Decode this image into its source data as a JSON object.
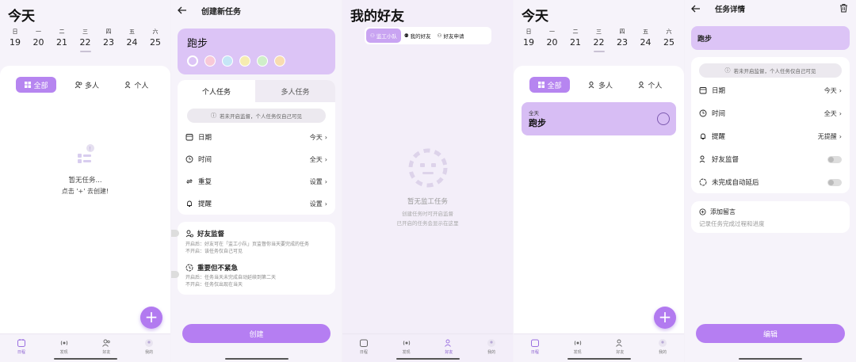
{
  "colors": {
    "accent": "#b57ef2",
    "accent_light": "#dcc4f6",
    "bg": "#f6f3fa"
  },
  "week": {
    "days": [
      "日",
      "一",
      "二",
      "三",
      "四",
      "五",
      "六"
    ],
    "dates": [
      "19",
      "20",
      "21",
      "22",
      "23",
      "24",
      "25"
    ],
    "selected_index": 3
  },
  "filter_tabs": [
    "全部",
    "多人",
    "个人"
  ],
  "bottom_nav": [
    "日程",
    "发现",
    "好友",
    "我的"
  ],
  "today_screen": {
    "title": "今天",
    "empty_line1": "暂无任务...",
    "empty_line2": "点击 '+' 去创建!",
    "fab": "+"
  },
  "create_screen": {
    "title": "创建新任务",
    "task_name": "跑步",
    "color_dots": [
      "#f8c9d8",
      "#c5e6f6",
      "#f6ecb1",
      "#cfeec9",
      "#f8dcb0"
    ],
    "tabs": [
      "个人任务",
      "多人任务"
    ],
    "notice": "若未开启监督，个人任务仅自己可见",
    "rows": [
      {
        "label": "日期",
        "value": "今天"
      },
      {
        "label": "时间",
        "value": "全天"
      },
      {
        "label": "重复",
        "value": "设置"
      },
      {
        "label": "提醒",
        "value": "设置"
      }
    ],
    "supervise_title": "好友监督",
    "supervise_desc1": "开启后：好友可在「监工小队」页监督你当天要完成的任务",
    "supervise_desc2": "不开启：该任务仅自己可见",
    "important_title": "重要但不紧急",
    "important_desc1": "开启后：任务当天未完成自动延续到第二天",
    "important_desc2": "不开启：任务仅出现在当天",
    "create_button": "创建"
  },
  "friends_screen": {
    "title": "我的好友",
    "tabs": [
      "监工小队",
      "我的好友",
      "好友申请"
    ],
    "empty_title": "暂无监工任务",
    "empty_line1": "创建任务时可开启监督",
    "empty_line2": "已开启的任务会显示在这里"
  },
  "today_task_screen": {
    "title": "今天",
    "task_tag": "全天",
    "task_name": "跑步",
    "fab": "+"
  },
  "detail_screen": {
    "title": "任务详情",
    "task_name": "跑步",
    "notice": "若未开启监督，个人任务仅自己可见",
    "rows": [
      {
        "label": "日期",
        "value": "今天"
      },
      {
        "label": "时间",
        "value": "全天"
      },
      {
        "label": "提醒",
        "value": "无提醒"
      }
    ],
    "toggles": [
      "好友监督",
      "未完成自动延后"
    ],
    "comment_title": "添加留言",
    "comment_placeholder": "记录任务完成过程和进度",
    "edit_button": "编辑"
  }
}
